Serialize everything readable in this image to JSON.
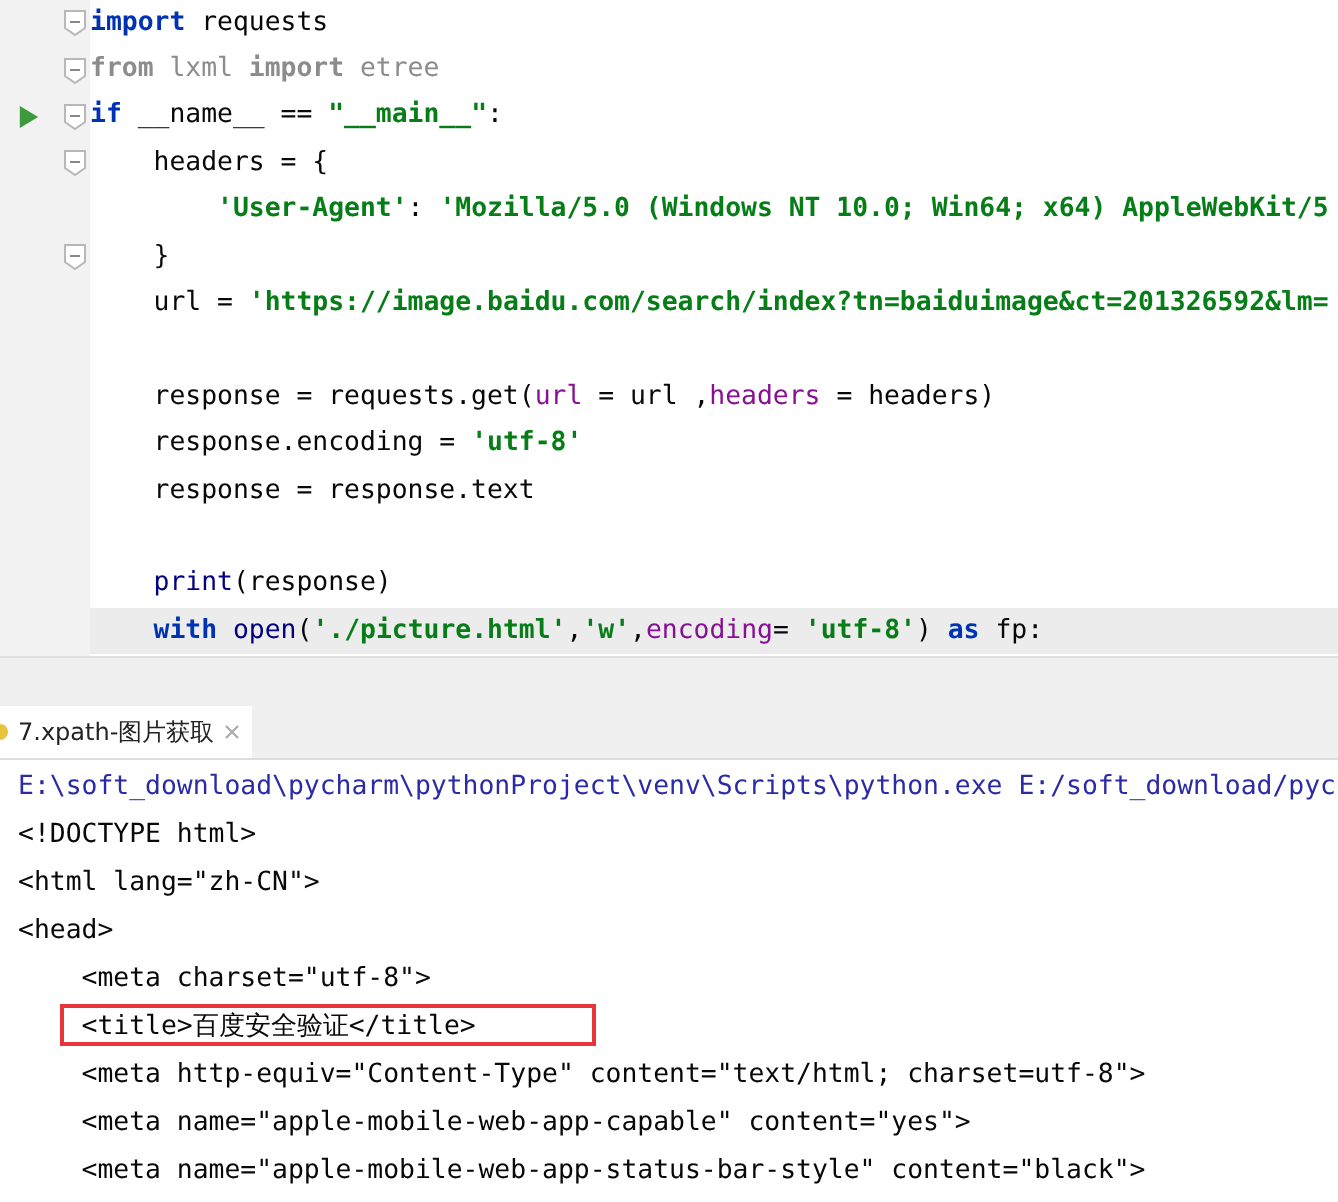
{
  "editor": {
    "lines": [
      {
        "kind": "code",
        "fold": true,
        "tokens": [
          {
            "t": "import",
            "kind": "kw"
          },
          {
            "t": " requests",
            "kind": "plain"
          }
        ]
      },
      {
        "kind": "code",
        "fold": true,
        "tokens": [
          {
            "t": "from",
            "kind": "kwdim"
          },
          {
            "t": " lxml ",
            "kind": "dim"
          },
          {
            "t": "import",
            "kind": "kwdim"
          },
          {
            "t": " etree",
            "kind": "dim"
          }
        ]
      },
      {
        "kind": "code",
        "fold": true,
        "run": true,
        "tokens": [
          {
            "t": "if",
            "kind": "kw"
          },
          {
            "t": " __name__ == ",
            "kind": "plain"
          },
          {
            "t": "\"__main__\"",
            "kind": "str"
          },
          {
            "t": ":",
            "kind": "plain"
          }
        ]
      },
      {
        "kind": "code",
        "fold": true,
        "tokens": [
          {
            "t": "    headers = {",
            "kind": "plain"
          }
        ]
      },
      {
        "kind": "code",
        "tokens": [
          {
            "t": "        'User-Agent'",
            "kind": "str"
          },
          {
            "t": ": ",
            "kind": "plain"
          },
          {
            "t": "'Mozilla/5.0 (Windows NT 10.0; Win64; x64) AppleWebKit/5",
            "kind": "str"
          }
        ]
      },
      {
        "kind": "code",
        "fold": true,
        "tokens": [
          {
            "t": "    }",
            "kind": "plain"
          }
        ]
      },
      {
        "kind": "code",
        "tokens": [
          {
            "t": "    url = ",
            "kind": "plain"
          },
          {
            "t": "'https://image.baidu.com/search/index?tn=baiduimage&ct=201326592&lm=",
            "kind": "str"
          }
        ]
      },
      {
        "kind": "blank"
      },
      {
        "kind": "code",
        "tokens": [
          {
            "t": "    response = requests.get(",
            "kind": "plain"
          },
          {
            "t": "url",
            "kind": "param"
          },
          {
            "t": " = url ,",
            "kind": "plain"
          },
          {
            "t": "headers",
            "kind": "param"
          },
          {
            "t": " = headers)",
            "kind": "plain"
          }
        ]
      },
      {
        "kind": "code",
        "tokens": [
          {
            "t": "    response.encoding = ",
            "kind": "plain"
          },
          {
            "t": "'utf-8'",
            "kind": "str"
          }
        ]
      },
      {
        "kind": "code",
        "tokens": [
          {
            "t": "    response = response.text",
            "kind": "plain"
          }
        ]
      },
      {
        "kind": "blank"
      },
      {
        "kind": "code",
        "tokens": [
          {
            "t": "    print",
            "kind": "builtin"
          },
          {
            "t": "(response)",
            "kind": "plain"
          }
        ]
      },
      {
        "kind": "code",
        "current": true,
        "tokens": [
          {
            "t": "    with",
            "kind": "kw"
          },
          {
            "t": " open",
            "kind": "builtin"
          },
          {
            "t": "(",
            "kind": "plain"
          },
          {
            "t": "'./picture.html'",
            "kind": "str"
          },
          {
            "t": ",",
            "kind": "plain"
          },
          {
            "t": "'w'",
            "kind": "str"
          },
          {
            "t": ",",
            "kind": "plain"
          },
          {
            "t": "encoding",
            "kind": "param"
          },
          {
            "t": "= ",
            "kind": "plain"
          },
          {
            "t": "'utf-8'",
            "kind": "str"
          },
          {
            "t": ") ",
            "kind": "plain"
          },
          {
            "t": "as",
            "kind": "kw"
          },
          {
            "t": " fp:",
            "kind": "plain"
          }
        ]
      }
    ]
  },
  "run_panel": {
    "tabs": [
      {
        "label": "7.xpath-图片获取",
        "selected": true
      }
    ],
    "lines": [
      {
        "text": "E:\\soft_download\\pycharm\\pythonProject\\venv\\Scripts\\python.exe E:/soft_download/pyc",
        "kind": "command"
      },
      {
        "text": "<!DOCTYPE html>",
        "kind": "output"
      },
      {
        "text": "<html lang=\"zh-CN\">",
        "kind": "output"
      },
      {
        "text": "<head>",
        "kind": "output"
      },
      {
        "text": "    <meta charset=\"utf-8\">",
        "kind": "output"
      },
      {
        "text": "    <title>百度安全验证</title>",
        "kind": "output",
        "highlight": true
      },
      {
        "text": "    <meta http-equiv=\"Content-Type\" content=\"text/html; charset=utf-8\">",
        "kind": "output"
      },
      {
        "text": "    <meta name=\"apple-mobile-web-app-capable\" content=\"yes\">",
        "kind": "output"
      },
      {
        "text": "    <meta name=\"apple-mobile-web-app-status-bar-style\" content=\"black\">",
        "kind": "output"
      }
    ]
  }
}
